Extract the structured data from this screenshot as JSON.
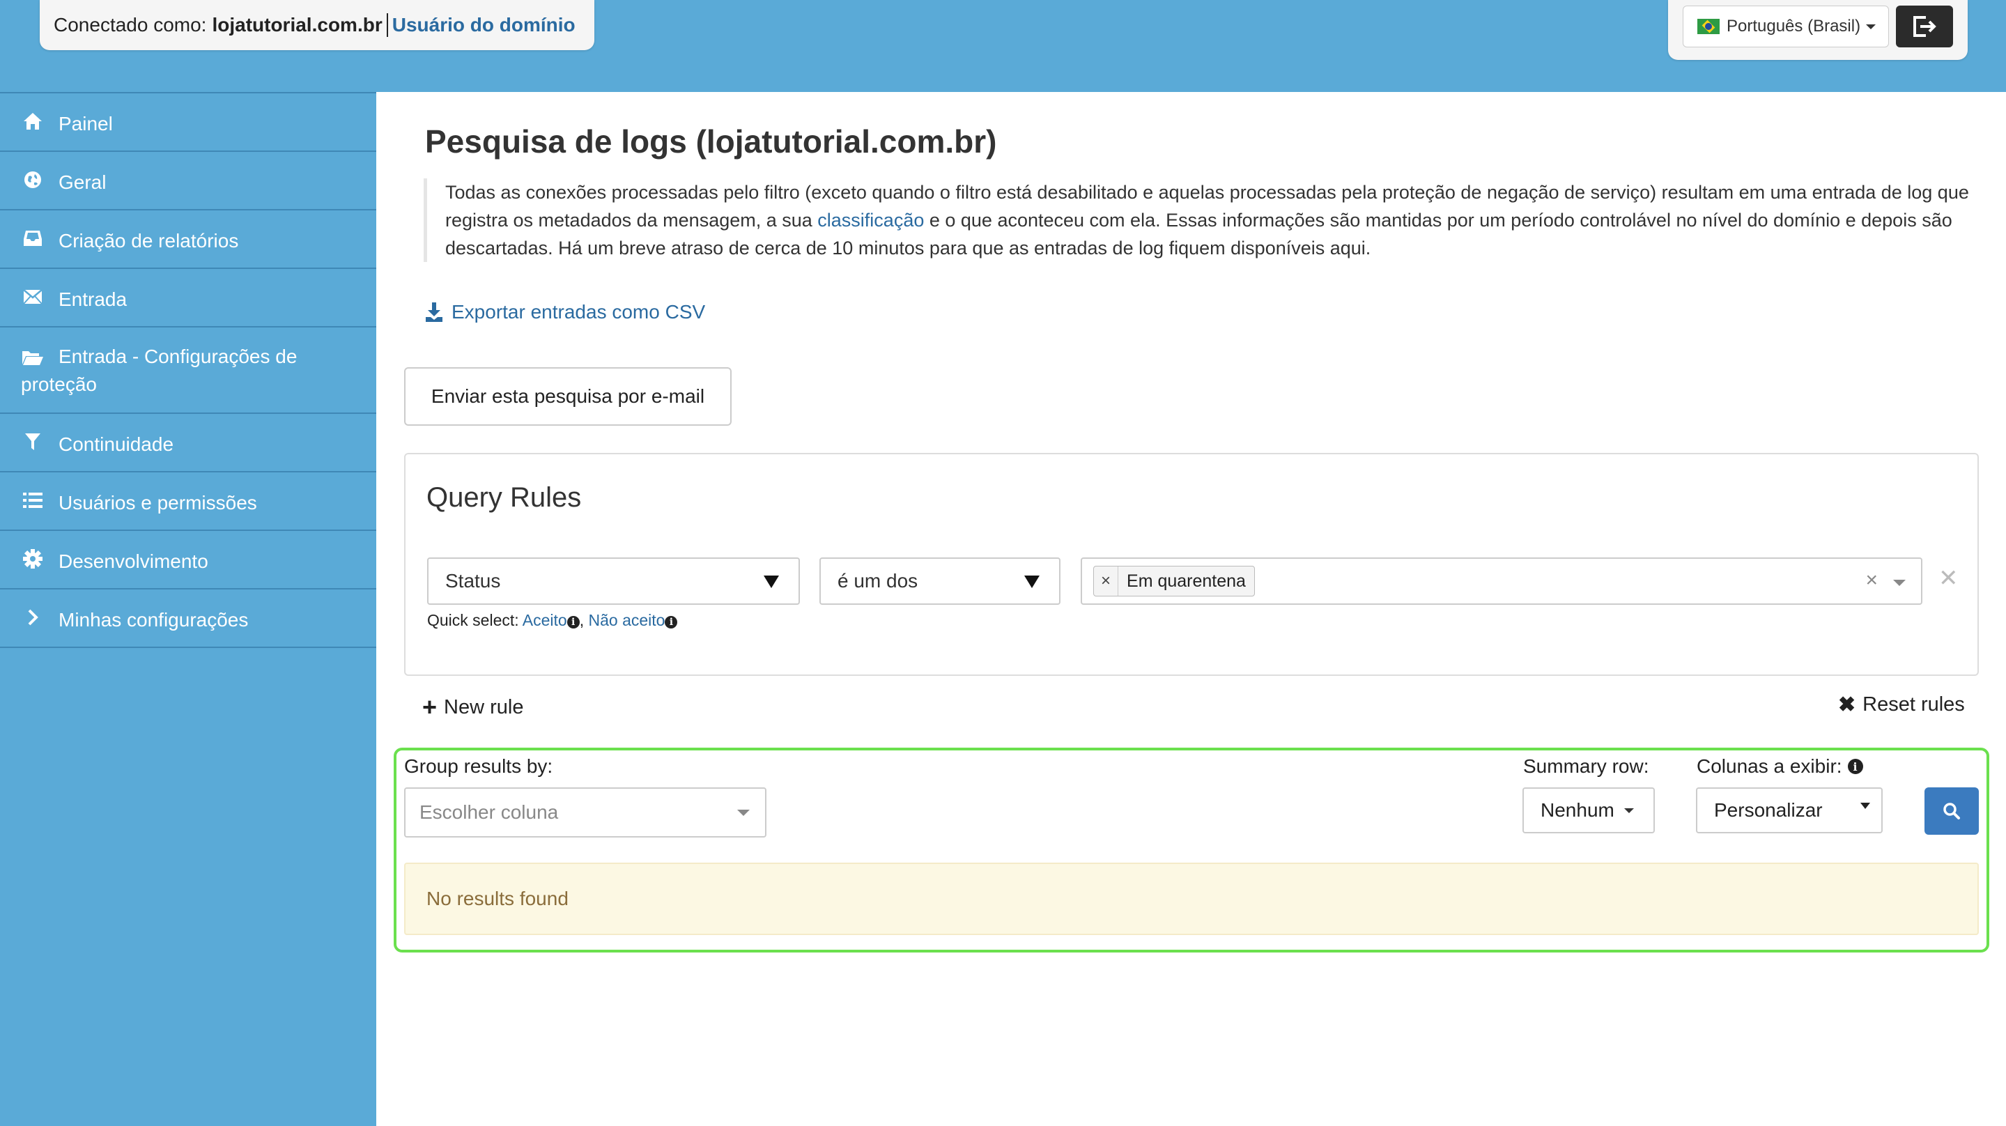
{
  "header": {
    "connected_label": "Conectado como:",
    "domain": "lojatutorial.com.br",
    "role": "Usuário do domínio",
    "language": "Português (Brasil)"
  },
  "sidebar": {
    "items": [
      {
        "label": "Painel",
        "icon": "home-icon"
      },
      {
        "label": "Geral",
        "icon": "globe-icon"
      },
      {
        "label": "Criação de relatórios",
        "icon": "inbox-icon"
      },
      {
        "label": "Entrada",
        "icon": "envelope-icon"
      },
      {
        "label": "Entrada - Configurações de proteção",
        "icon": "folder-open-icon"
      },
      {
        "label": "Continuidade",
        "icon": "filter-icon"
      },
      {
        "label": "Usuários e permissões",
        "icon": "list-icon"
      },
      {
        "label": "Desenvolvimento",
        "icon": "gear-icon"
      },
      {
        "label": "Minhas configurações",
        "icon": "chevron-right-icon"
      }
    ]
  },
  "main": {
    "title": "Pesquisa de logs (lojatutorial.com.br)",
    "description_part1": "Todas as conexões processadas pelo filtro (exceto quando o filtro está desabilitado e aquelas processadas pela proteção de negação de serviço) resultam em uma entrada de log que registra os metadados da mensagem, a sua ",
    "description_link": "classificação",
    "description_part2": " e o que aconteceu com ela. Essas informações são mantidas por um período controlável no nível do domínio e depois são descartadas. Há um breve atraso de cerca de 10 minutos para que as entradas de log fiquem disponíveis aqui.",
    "export_label": "Exportar entradas como CSV",
    "email_button": "Enviar esta pesquisa por e-mail"
  },
  "query_rules": {
    "title": "Query Rules",
    "field": "Status",
    "operator": "é um dos",
    "tag": "Em quarentena",
    "quick_select_label": "Quick select:",
    "quick_accepted": "Aceito",
    "quick_not_accepted": "Não aceito",
    "new_rule": "New rule",
    "reset_rules": "Reset rules"
  },
  "results": {
    "group_label": "Group results by:",
    "group_placeholder": "Escolher coluna",
    "summary_label": "Summary row:",
    "summary_value": "Nenhum",
    "columns_label": "Colunas a exibir:",
    "columns_value": "Personalizar",
    "no_results": "No results found"
  },
  "colors": {
    "header_blue": "#5aaad7",
    "link_blue": "#2a6aa0",
    "highlight_green": "#6be04e",
    "search_button": "#3b7bbf"
  }
}
